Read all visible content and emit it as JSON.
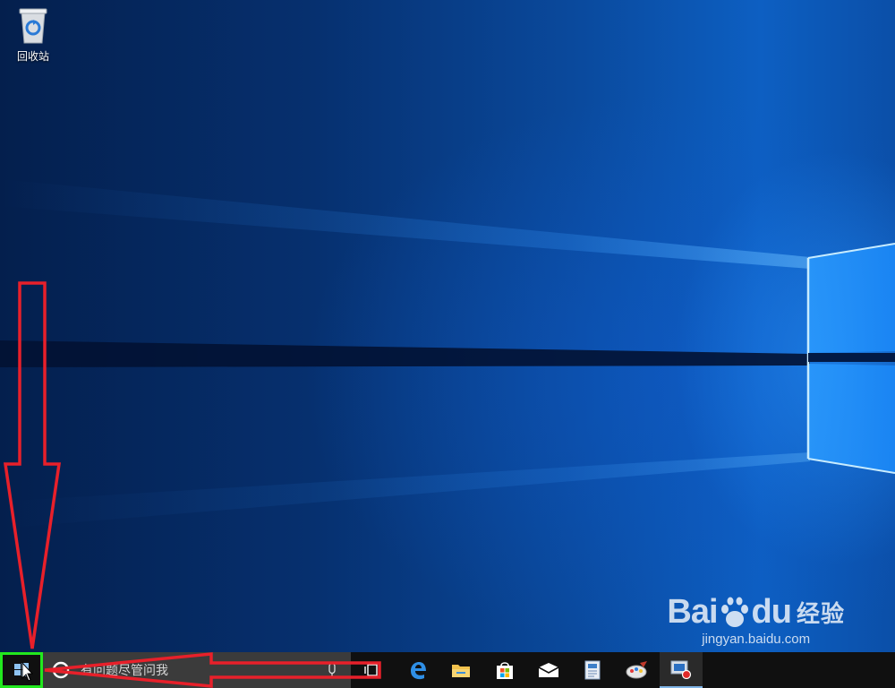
{
  "desktop": {
    "icons": [
      {
        "label": "回收站",
        "icon": "recycle-bin-icon"
      }
    ]
  },
  "taskbar": {
    "start_icon": "windows-logo-icon",
    "search": {
      "placeholder": "有问题尽管问我",
      "icon": "cortana-circle-icon",
      "mic_icon": "microphone-icon"
    },
    "task_view_icon": "task-view-icon",
    "pinned": [
      {
        "app": "edge",
        "icon": "edge-icon"
      },
      {
        "app": "file-explorer",
        "icon": "folder-icon"
      },
      {
        "app": "store",
        "icon": "store-bag-icon"
      },
      {
        "app": "mail",
        "icon": "mail-icon"
      },
      {
        "app": "news",
        "icon": "document-icon"
      },
      {
        "app": "paint",
        "icon": "paint-icon"
      },
      {
        "app": "screen-recorder",
        "icon": "recorder-icon"
      }
    ]
  },
  "watermark": {
    "brand": "Bai",
    "brand_suffix": "du",
    "brand_cn": "经验",
    "url": "jingyan.baidu.com"
  },
  "annotation": {
    "color": "#e8202a",
    "highlight_color": "#22e81e"
  }
}
